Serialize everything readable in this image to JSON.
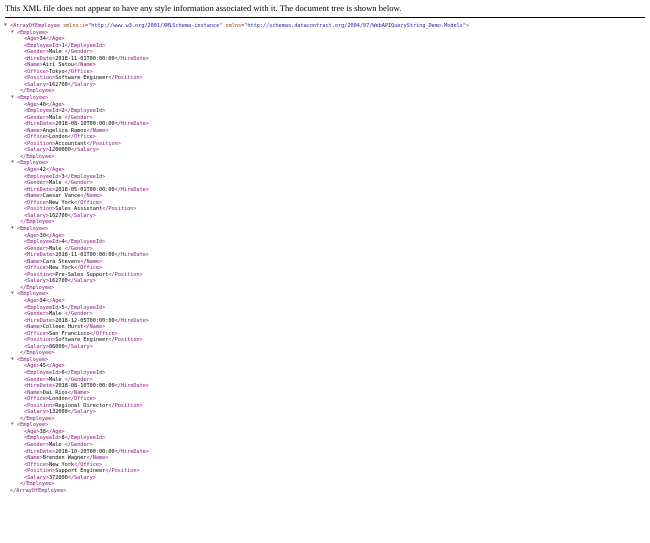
{
  "notice": "This XML file does not appear to have any style information associated with it. The document tree is shown below.",
  "root": {
    "tag": "ArrayOfEmployee",
    "attrs": [
      {
        "name": "xmlns:i",
        "value": "http://www.w3.org/2001/XMLSchema-instance"
      },
      {
        "name": "xmlns",
        "value": "http://schemas.datacontract.org/2004/07/WebAPIQueryString_Demo.Models"
      }
    ]
  },
  "item_tag": "Employee",
  "fields": [
    "Age",
    "EmployeeId",
    "Gender",
    "HireDate",
    "Name",
    "Office",
    "Position",
    "Salary"
  ],
  "employees": [
    {
      "Age": "34",
      "EmployeeId": "1",
      "Gender": "Male ",
      "HireDate": "2018-11-01T00:00:00",
      "Name": "Airi Satou",
      "Office": "Tokyo",
      "Position": "Software Engineer",
      "Salary": "162700"
    },
    {
      "Age": "40",
      "EmployeeId": "2",
      "Gender": "Male ",
      "HireDate": "2018-08-10T00:00:00",
      "Name": "Angelica Ramos",
      "Office": "London",
      "Position": "Accountant",
      "Salary": "1200000"
    },
    {
      "Age": "42",
      "EmployeeId": "3",
      "Gender": "Male ",
      "HireDate": "2018-05-01T00:00:00",
      "Name": "Caesar Vance",
      "Office": "New York",
      "Position": "Sales Assistant",
      "Salary": "162700"
    },
    {
      "Age": "30",
      "EmployeeId": "4",
      "Gender": "Male ",
      "HireDate": "2018-11-01T00:00:00",
      "Name": "Cara Stevens",
      "Office": "New York",
      "Position": "Pre-Sales Support",
      "Salary": "162700"
    },
    {
      "Age": "34",
      "EmployeeId": "5",
      "Gender": "Male ",
      "HireDate": "2018-12-05T00:00:00",
      "Name": "Colleen Hurst",
      "Office": "San Francisco",
      "Position": "Software Engineer",
      "Salary": "86000"
    },
    {
      "Age": "45",
      "EmployeeId": "6",
      "Gender": "Male ",
      "HireDate": "2018-08-10T00:00:00",
      "Name": "Dai Rios",
      "Office": "London",
      "Position": "Regional Director",
      "Salary": "132000"
    },
    {
      "Age": "38",
      "EmployeeId": "8",
      "Gender": "Male ",
      "HireDate": "2018-10-20T00:00:00",
      "Name": "Brenden Wagner",
      "Office": "New York",
      "Position": "Support Engineer",
      "Salary": "372000"
    }
  ],
  "colors": {
    "tag": "#881280",
    "attr_name": "#994500",
    "attr_value": "#1a1aa6"
  }
}
